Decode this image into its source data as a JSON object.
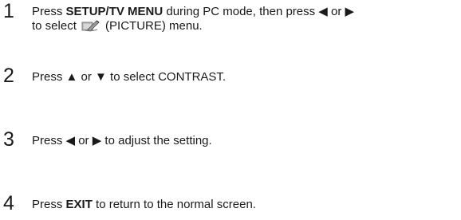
{
  "steps": [
    {
      "number": "1",
      "parts": {
        "p1": "Press ",
        "b1": "SETUP/TV MENU",
        "p2": " during PC mode, then press ◀ or ▶",
        "line2_pre": "to select",
        "icon": "picture-menu-icon",
        "line2_post": " (PICTURE) menu."
      }
    },
    {
      "number": "2",
      "parts": {
        "p1": "Press ▲ or ▼ to select CONTRAST."
      }
    },
    {
      "number": "3",
      "parts": {
        "p1": "Press ◀ or ▶ to adjust the setting."
      }
    },
    {
      "number": "4",
      "parts": {
        "p1": "Press ",
        "b1": "EXIT",
        "p2": " to return to the normal screen."
      }
    }
  ]
}
